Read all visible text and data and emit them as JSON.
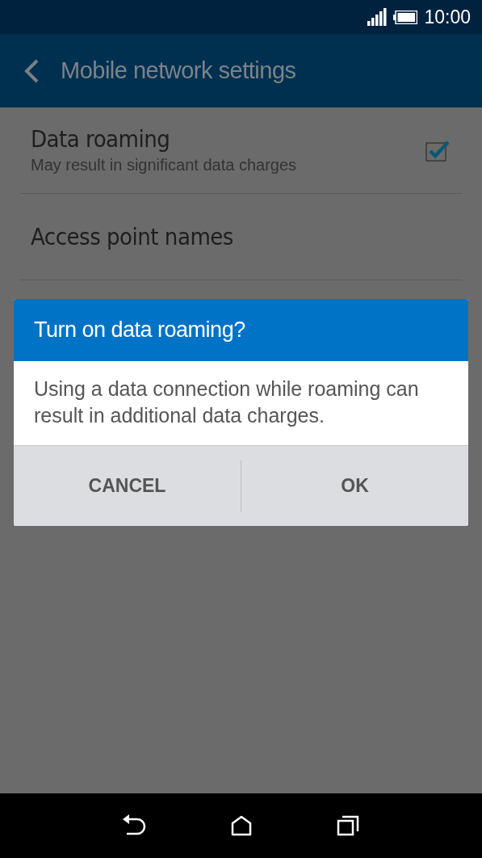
{
  "status_bar": {
    "time": "10:00"
  },
  "app_bar": {
    "title": "Mobile network settings"
  },
  "settings": [
    {
      "kind": "checkbox",
      "title": "Data roaming",
      "subtitle": "May result in significant data charges",
      "checked": true
    },
    {
      "kind": "link",
      "title": "Access point names"
    }
  ],
  "dialog": {
    "title": "Turn on data roaming?",
    "message": "Using a data connection while roaming can result in additional data charges.",
    "buttons": [
      "CANCEL",
      "OK"
    ]
  }
}
